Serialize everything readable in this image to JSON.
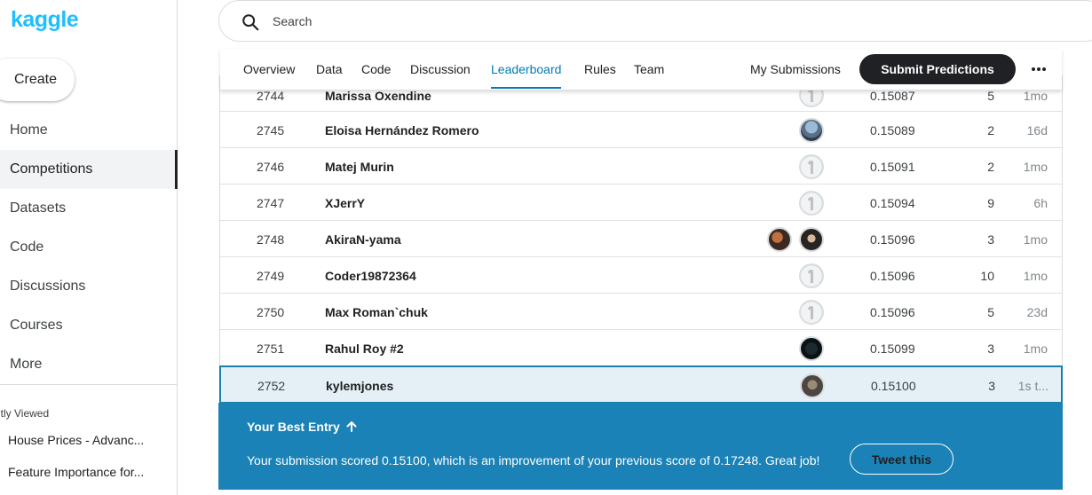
{
  "app": {
    "logo": "kaggle"
  },
  "sidebar": {
    "create_label": "Create",
    "items": [
      {
        "label": "Home",
        "active": false
      },
      {
        "label": "Competitions",
        "active": true
      },
      {
        "label": "Datasets",
        "active": false
      },
      {
        "label": "Code",
        "active": false
      },
      {
        "label": "Discussions",
        "active": false
      },
      {
        "label": "Courses",
        "active": false
      },
      {
        "label": "More",
        "active": false
      }
    ],
    "recent_title": "ntly Viewed",
    "recent_items": [
      "House Prices - Advanc...",
      "Feature Importance for..."
    ]
  },
  "search": {
    "placeholder": "Search",
    "icon": "search-icon"
  },
  "tabs": {
    "items": [
      "Overview",
      "Data",
      "Code",
      "Discussion",
      "Leaderboard",
      "Rules",
      "Team"
    ],
    "active": "Leaderboard",
    "my_submissions": "My Submissions",
    "submit": "Submit Predictions",
    "more_icon": "more-horizontal-icon"
  },
  "leaderboard": {
    "rows": [
      {
        "rank": "2744",
        "team": "Marissa Oxendine",
        "score": "0.15087",
        "entries": "5",
        "last": "1mo"
      },
      {
        "rank": "2745",
        "team": "Eloisa Hernández Romero",
        "score": "0.15089",
        "entries": "2",
        "last": "16d"
      },
      {
        "rank": "2746",
        "team": "Matej Murin",
        "score": "0.15091",
        "entries": "2",
        "last": "1mo"
      },
      {
        "rank": "2747",
        "team": "XJerrY",
        "score": "0.15094",
        "entries": "9",
        "last": "6h"
      },
      {
        "rank": "2748",
        "team": "AkiraN-yama",
        "score": "0.15096",
        "entries": "3",
        "last": "1mo"
      },
      {
        "rank": "2749",
        "team": "Coder19872364",
        "score": "0.15096",
        "entries": "10",
        "last": "1mo"
      },
      {
        "rank": "2750",
        "team": "Max Roman`chuk",
        "score": "0.15096",
        "entries": "5",
        "last": "23d"
      },
      {
        "rank": "2751",
        "team": "Rahul Roy #2",
        "score": "0.15099",
        "entries": "3",
        "last": "1mo"
      },
      {
        "rank": "2752",
        "team": "kylemjones",
        "score": "0.15100",
        "entries": "3",
        "last": "1s t..."
      }
    ]
  },
  "banner": {
    "title": "Your Best Entry",
    "arrow_icon": "arrow-up-icon",
    "message": "Your submission scored 0.15100, which is an improvement of your previous score of 0.17248. Great job!",
    "tweet": "Tweet this"
  },
  "colors": {
    "brand": "#20beff",
    "accent": "#007bb5",
    "banner": "#1a82b6",
    "highlight_row": "#e4f0f5",
    "progress_ring": "#20c36e"
  }
}
